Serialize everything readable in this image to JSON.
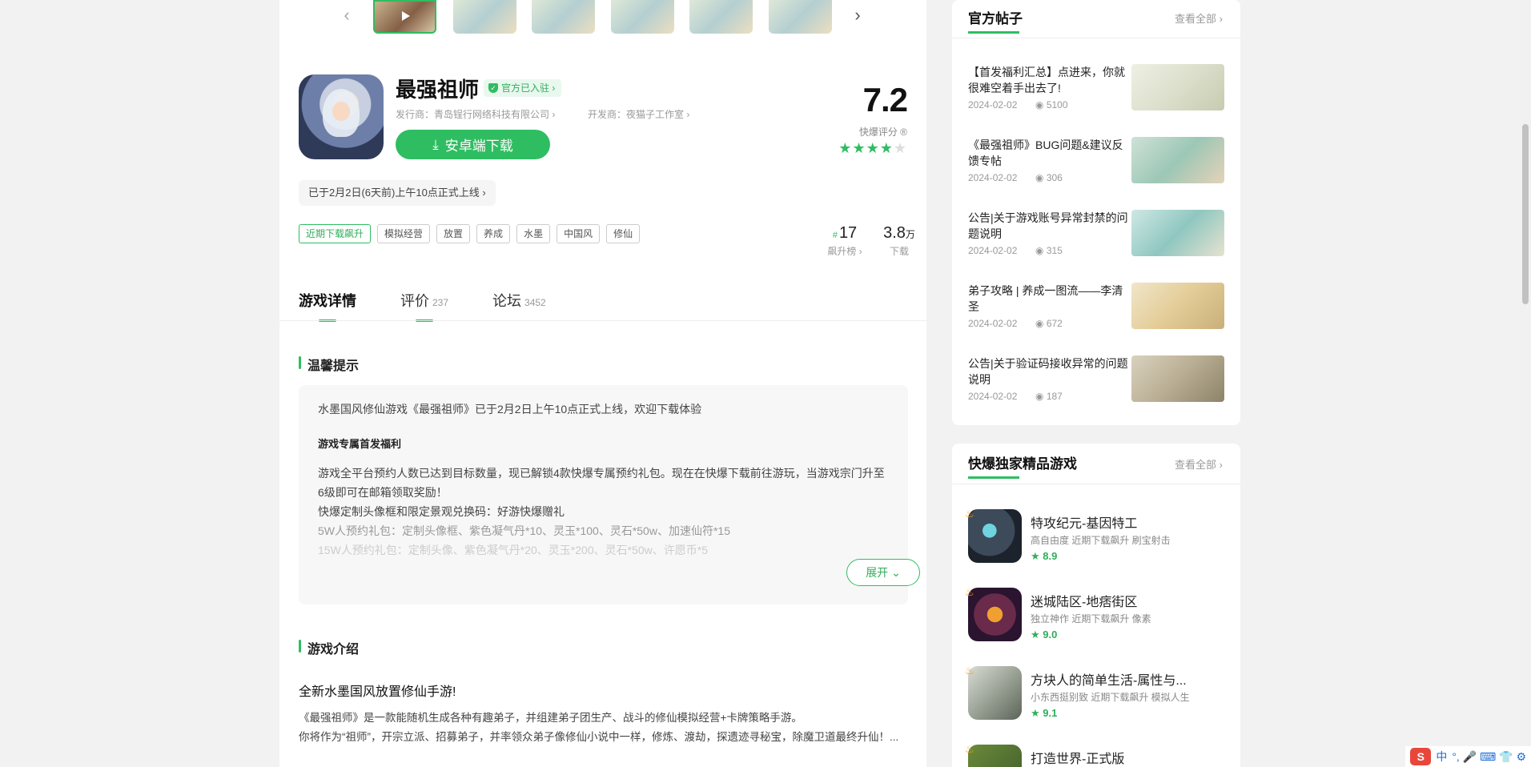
{
  "game": {
    "title": "最强祖师",
    "official_badge": "官方已入驻 ›",
    "publisher": "发行商：青岛锃行网络科技有限公司 ›",
    "developer": "开发商：夜猫子工作室 ›",
    "download_label": "安卓端下载",
    "score": "7.2",
    "score_label": "快爆评分 ®",
    "rating_stars": 3.5,
    "launch_note": "已于2月2日(6天前)上午10点正式上线 ›",
    "tags": [
      "近期下载飙升",
      "模拟经营",
      "放置",
      "养成",
      "水墨",
      "中国风",
      "修仙"
    ],
    "rank_number": "17",
    "rank_prefix": "#",
    "rank_label": "飙升榜 ›",
    "downloads_number": "3.8",
    "downloads_unit": "万",
    "downloads_label": "下载"
  },
  "nav": {
    "prev_arrow": "‹",
    "next_arrow": "›"
  },
  "tabs": [
    {
      "label": "游戏详情",
      "count": ""
    },
    {
      "label": "评价",
      "count": "237"
    },
    {
      "label": "论坛",
      "count": "3452"
    }
  ],
  "notice": {
    "heading": "温馨提示",
    "line1": "水墨国风修仙游戏《最强祖师》已于2月2日上午10点正式上线，欢迎下载体验",
    "bold": "游戏专属首发福利",
    "p1": "游戏全平台预约人数已达到目标数量，现已解锁4款快爆专属预约礼包。现在在快爆下载前往游玩，当游戏宗门升至6级即可在邮箱领取奖励！",
    "p2": "快爆定制头像框和限定景观兑换码：好游快爆赠礼",
    "p3": "5W人预约礼包：定制头像框、紫色凝气丹*10、灵玉*100、灵石*50w、加速仙符*15",
    "p4": "15W人预约礼包：定制头像、紫色凝气丹*20、灵玉*200、灵石*50w、许愿币*5",
    "expand": "展开 ⌄"
  },
  "intro": {
    "heading": "游戏介绍",
    "subtitle": "全新水墨国风放置修仙手游!",
    "p1": "《最强祖师》是一款能随机生成各种有趣弟子，并组建弟子团生产、战斗的修仙模拟经营+卡牌策略手游。",
    "p2": "你将作为“祖师”，开宗立派、招募弟子，并率领众弟子像修仙小说中一样，修炼、渡劫，探遗迹寻秘宝，除魔卫道最终升仙！..."
  },
  "posts": {
    "title": "官方帖子",
    "see_all": "查看全部 ›",
    "items": [
      {
        "title": "【首发福利汇总】点进来，你就很难空着手出去了!",
        "date": "2024-02-02",
        "views": "5100"
      },
      {
        "title": "《最强祖师》BUG问题&建议反馈专帖",
        "date": "2024-02-02",
        "views": "306"
      },
      {
        "title": "公告|关于游戏账号异常封禁的问题说明",
        "date": "2024-02-02",
        "views": "315"
      },
      {
        "title": "弟子攻略 | 养成一图流——李清圣",
        "date": "2024-02-02",
        "views": "672"
      },
      {
        "title": "公告|关于验证码接收异常的问题说明",
        "date": "2024-02-02",
        "views": "187"
      }
    ]
  },
  "games": {
    "title": "快爆独家精品游戏",
    "see_all": "查看全部 ›",
    "items": [
      {
        "name": "特攻纪元-基因特工",
        "tags": "高自由度   近期下载飙升   刷宝射击",
        "score": "★ 8.9"
      },
      {
        "name": "迷城陆区-地痞街区",
        "tags": "独立神作   近期下载飙升   像素",
        "score": "★ 9.0"
      },
      {
        "name": "方块人的简单生活-属性与...",
        "tags": "小东西挺别致   近期下载飙升   模拟人生",
        "score": "★ 9.1"
      },
      {
        "name": "打造世界-正式版",
        "tags": "",
        "score": ""
      }
    ]
  },
  "ime": {
    "logo": "S",
    "mode": "中",
    "icons": "°, 🎤 ⌨ 👕 ⚙"
  }
}
